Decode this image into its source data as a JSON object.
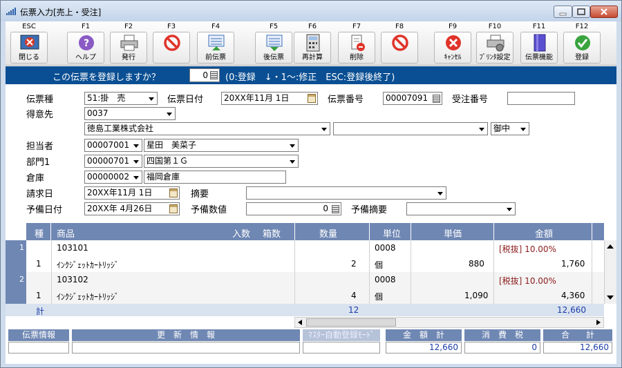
{
  "window": {
    "title": "伝票入力[売上・受注]"
  },
  "toolbar": {
    "buttons": [
      {
        "key": "ESC",
        "label": "閉じる",
        "icon": "close-window-icon"
      },
      {
        "key": "F1",
        "label": "ヘルプ",
        "icon": "help-icon"
      },
      {
        "key": "F2",
        "label": "発行",
        "icon": "print-icon"
      },
      {
        "key": "F3",
        "label": "",
        "icon": "disabled-icon"
      },
      {
        "key": "F4",
        "label": "前伝票",
        "icon": "prev-slip-icon"
      },
      {
        "key": "F5",
        "label": "後伝票",
        "icon": "next-slip-icon"
      },
      {
        "key": "F6",
        "label": "再計算",
        "icon": "calculator-icon"
      },
      {
        "key": "F7",
        "label": "削除",
        "icon": "delete-icon"
      },
      {
        "key": "F8",
        "label": "",
        "icon": "disabled-icon"
      },
      {
        "key": "F9",
        "label": "ｷｬﾝｾﾙ",
        "icon": "cancel-icon"
      },
      {
        "key": "F10",
        "label": "ﾌﾟﾘﾝﾀ設定",
        "icon": "printer-settings-icon"
      },
      {
        "key": "F11",
        "label": "伝票機能",
        "icon": "slip-function-icon"
      },
      {
        "key": "F12",
        "label": "登録",
        "icon": "register-icon"
      }
    ]
  },
  "prompt": {
    "question": "この伝票を登録しますか？",
    "value": "0",
    "hint": "(0:登録　↓・1～:修正　ESC:登録後終了)"
  },
  "form": {
    "slip_type_label": "伝票種",
    "slip_type": "51:掛　売",
    "slip_date_label": "伝票日付",
    "slip_date": "20XX年11月 1日",
    "slip_no_label": "伝票番号",
    "slip_no": "00007091",
    "order_no_label": "受注番号",
    "order_no": "",
    "customer_label": "得意先",
    "customer_code": "0037",
    "customer_name": "徳島工業株式会社",
    "customer_sub": "",
    "honorific": "御中",
    "staff_label": "担当者",
    "staff_code": "00007001",
    "staff_name": "星田　美菜子",
    "dept_label": "部門1",
    "dept_code": "00000701",
    "dept_name": "四国第１Ｇ",
    "warehouse_label": "倉庫",
    "warehouse_code": "00000002",
    "warehouse_name": "福岡倉庫",
    "bill_date_label": "請求日",
    "bill_date": "20XX年11月 1日",
    "summary_label": "摘要",
    "summary": "",
    "spare_date_label": "予備日付",
    "spare_date": "20XX年 4月26日",
    "spare_num_label": "予備数値",
    "spare_num": "0",
    "spare_summary_label": "予備摘要",
    "spare_summary": ""
  },
  "grid": {
    "headers": {
      "type": "種",
      "product": "商品",
      "in_qty": "入数",
      "box_qty": "箱数",
      "qty": "数量",
      "unit": "単位",
      "price": "単価",
      "amount": "金額"
    },
    "rows": [
      {
        "no": "1",
        "type": "1",
        "code": "103101",
        "name": "ｲﾝｸｼﾞｪｯﾄｶｰﾄﾘｯｼﾞ",
        "qty": "2",
        "unit_code": "0008",
        "unit": "個",
        "price": "880",
        "tax": "[税抜] 10.00%",
        "amount": "1,760"
      },
      {
        "no": "2",
        "type": "1",
        "code": "103102",
        "name": "ｲﾝｸｼﾞｪｯﾄｶｰﾄﾘｯｼﾞ",
        "qty": "4",
        "unit_code": "0008",
        "unit": "個",
        "price": "1,090",
        "tax": "[税抜] 10.00%",
        "amount": "4,360"
      }
    ],
    "total_label": "計",
    "total_qty": "12",
    "total_amount": "12,660"
  },
  "footer": {
    "slip_info_label": "伝票情報",
    "update_info_label": "更　新　情　報",
    "master_mode_label": "ﾏｽﾀｰ自動登録ﾓｰﾄﾞ",
    "amount_total_label": "金　額　計",
    "tax_label": "消　費　税",
    "grand_total_label": "合　　計",
    "amount_total": "12,660",
    "tax": "0",
    "grand_total": "12,660"
  },
  "colors": {
    "accent": "#0a4f93",
    "grid_header": "#6f87b3",
    "tax_text": "#8b1a1a",
    "total_text": "#1b3da8"
  }
}
